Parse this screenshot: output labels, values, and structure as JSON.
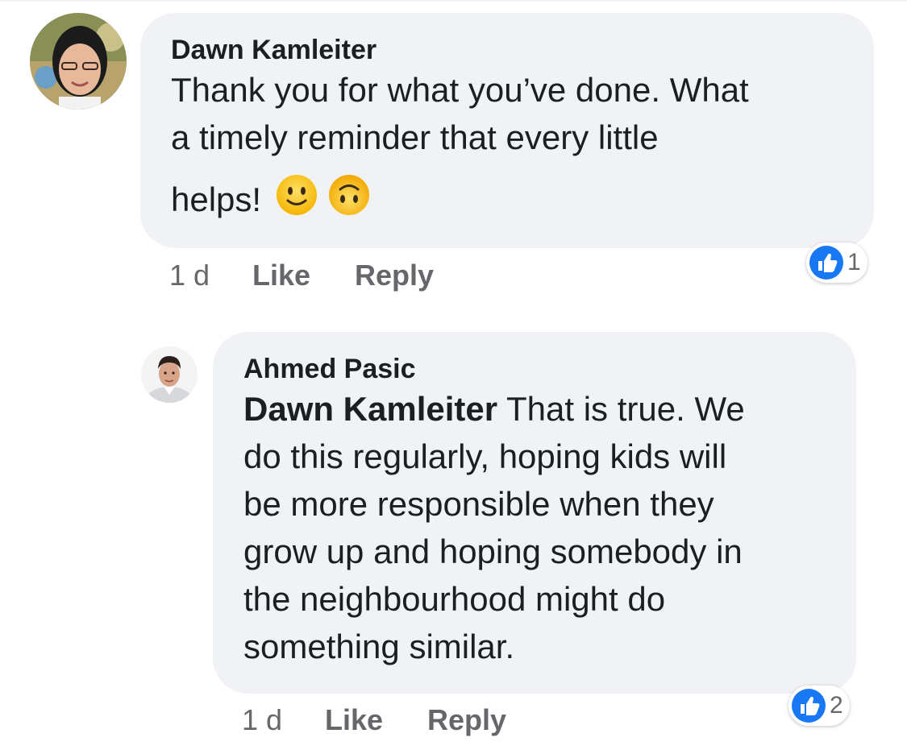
{
  "comments": [
    {
      "author": "Dawn Kamleiter",
      "lines": [
        "Thank you for what you’ve done. What",
        "a timely reminder that every little",
        "helps!"
      ],
      "emojis": [
        "slightly-smiling-face",
        "upside-down-face"
      ],
      "time": "1 d",
      "like_label": "Like",
      "reply_label": "Reply",
      "reaction_count": "1"
    },
    {
      "author": "Ahmed Pasic",
      "mention": "Dawn Kamleiter",
      "first_line_rest": " That is true. We",
      "lines": [
        "do this regularly, hoping kids will",
        "be more responsible when they",
        "grow up and hoping somebody in",
        "the neighbourhood might do",
        "something similar."
      ],
      "time": "1 d",
      "like_label": "Like",
      "reply_label": "Reply",
      "reaction_count": "2"
    }
  ],
  "colors": {
    "bubble": "#f0f2f5",
    "secondary_text": "#65676b",
    "like_blue": "#1877f2",
    "emoji_yellow": "#f7c843"
  },
  "icons": {
    "reaction": "thumbs-up-icon",
    "emoji_1": "slightly-smiling-face",
    "emoji_2": "upside-down-face"
  }
}
